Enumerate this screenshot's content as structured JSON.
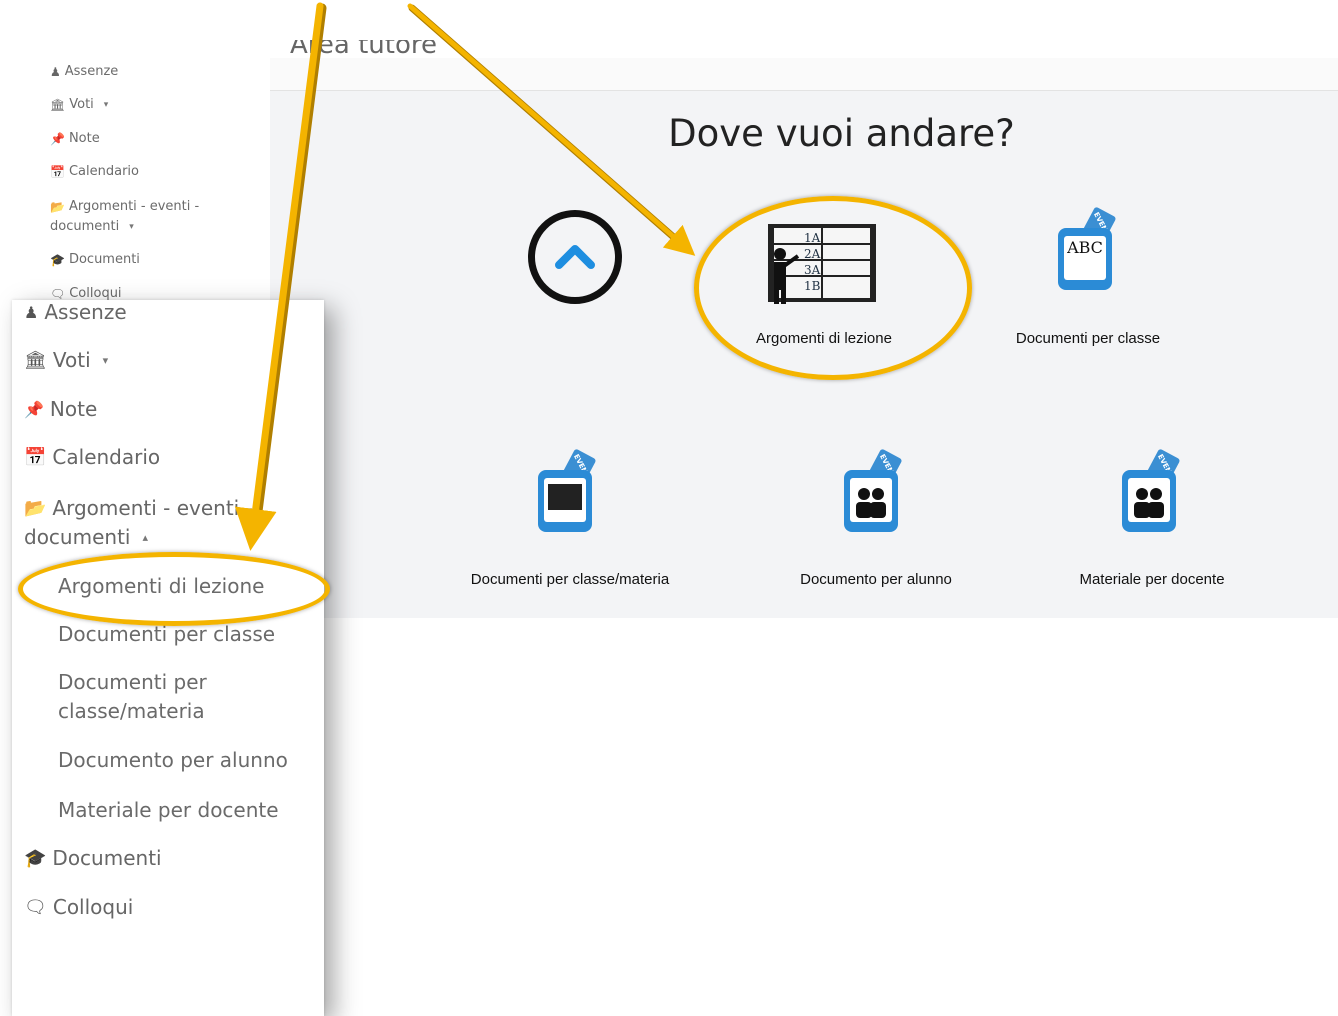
{
  "bg_sidebar": {
    "items": [
      {
        "icon": "user-icon",
        "label": "Assenze"
      },
      {
        "icon": "bank-icon",
        "label": "Voti"
      },
      {
        "icon": "pin-icon",
        "label": "Note"
      },
      {
        "icon": "calendar-icon",
        "label": "Calendario"
      },
      {
        "icon": "folder-icon",
        "label": "Argomenti - eventi -"
      },
      {
        "icon": "",
        "label": "documenti"
      },
      {
        "icon": "graduation-cap-icon",
        "label": "Documenti"
      },
      {
        "icon": "chat-icon",
        "label": "Colloqui"
      }
    ]
  },
  "main": {
    "partial_title": "Area tutore",
    "heading": "Dove vuoi andare?",
    "tiles": [
      {
        "label": "Argomenti di lezione"
      },
      {
        "label": "Documenti per classe"
      },
      {
        "label": "Documenti per classe/materia"
      },
      {
        "label": "Documento per alunno"
      },
      {
        "label": "Materiale per docente"
      }
    ],
    "board_rows": [
      "1A",
      "2A",
      "3A",
      "1B"
    ],
    "doc_tag_text": "EVEN",
    "abc_text": "ABC"
  },
  "overlay_sidebar": {
    "items": [
      "Assenze",
      "Voti",
      "Note",
      "Calendario",
      "Argomenti - eventi -",
      "documenti",
      "Documenti",
      "Colloqui"
    ],
    "submenu": [
      "Argomenti di lezione",
      "Documenti per classe",
      "Documenti per",
      "classe/materia",
      "Documento per alunno",
      "Materiale per docente"
    ]
  },
  "colors": {
    "highlight": "#f4b400",
    "accent": "#2b8bd6",
    "arrow": "#f4b400"
  }
}
